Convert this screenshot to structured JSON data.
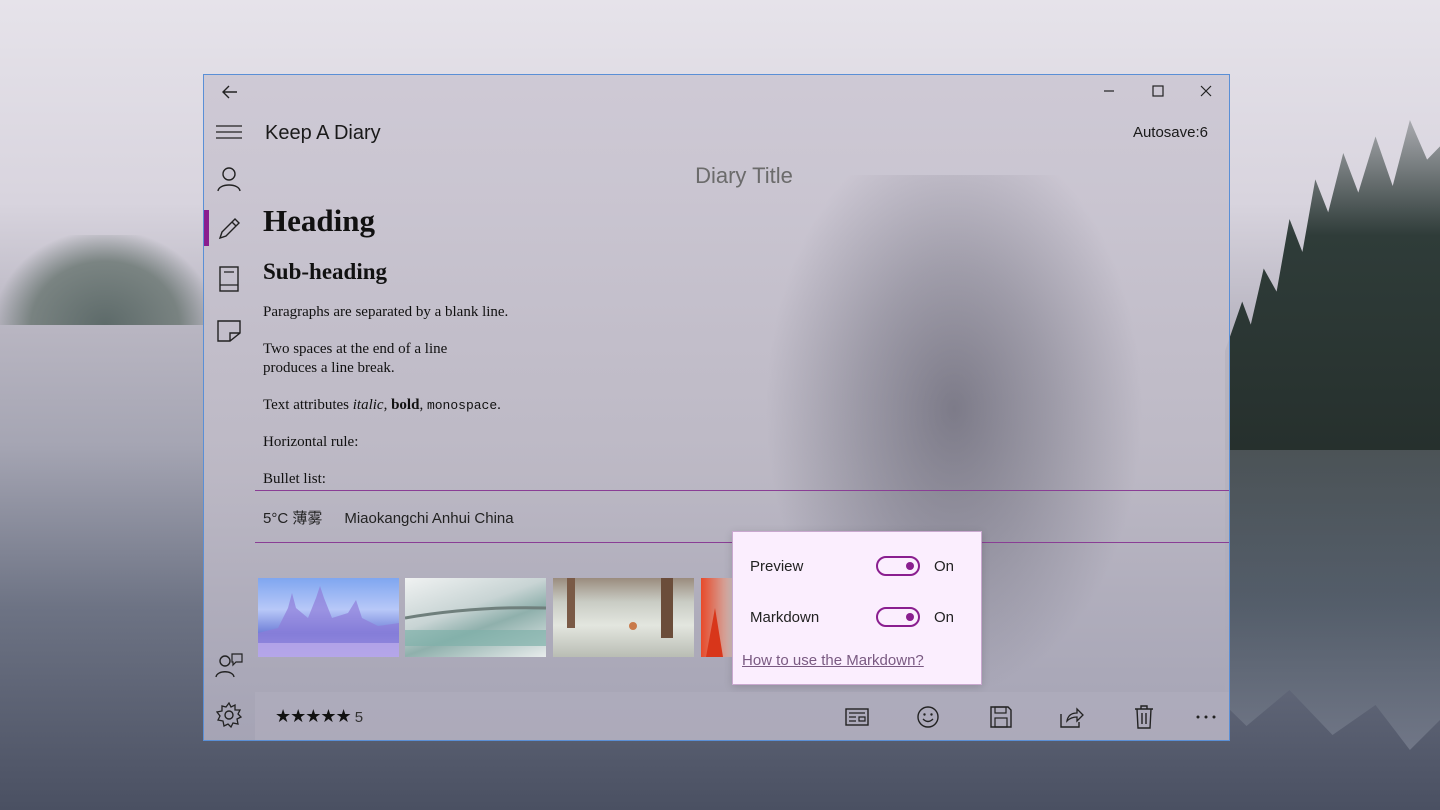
{
  "window": {
    "app_title": "Keep A Diary",
    "autosave": "Autosave:6",
    "diary_title_placeholder": "Diary Title"
  },
  "content": {
    "heading": "Heading",
    "subheading": "Sub-heading",
    "paragraph1": "Paragraphs are separated by a blank line.",
    "paragraph2_line1": "Two spaces at the end of a line",
    "paragraph2_line2": "produces a line break.",
    "attributes_prefix": "Text attributes ",
    "italic": "italic",
    "comma1": ", ",
    "bold": "bold",
    "comma2": ", ",
    "monospace": "monospace",
    "period": ".",
    "horizontal_rule": "Horizontal rule:",
    "bullet_list": "Bullet list:"
  },
  "weather": {
    "temperature": "5°C 薄雾",
    "location": "Miaokangchi Anhui China"
  },
  "popup": {
    "preview_label": "Preview",
    "preview_state": "On",
    "markdown_label": "Markdown",
    "markdown_state": "On",
    "help_link": "How to use the Markdown?"
  },
  "rating": {
    "stars": "★★★★★",
    "value": "5"
  },
  "colors": {
    "accent": "#8a1e8f",
    "window_border": "#5a8fd6"
  },
  "icons": [
    "back-icon",
    "minimize-icon",
    "maximize-icon",
    "close-icon",
    "hamburger-icon",
    "person-icon",
    "pencil-icon",
    "book-icon",
    "note-icon",
    "feedback-icon",
    "gear-icon",
    "card-icon",
    "emoji-icon",
    "save-icon",
    "share-icon",
    "delete-icon",
    "more-icon"
  ]
}
